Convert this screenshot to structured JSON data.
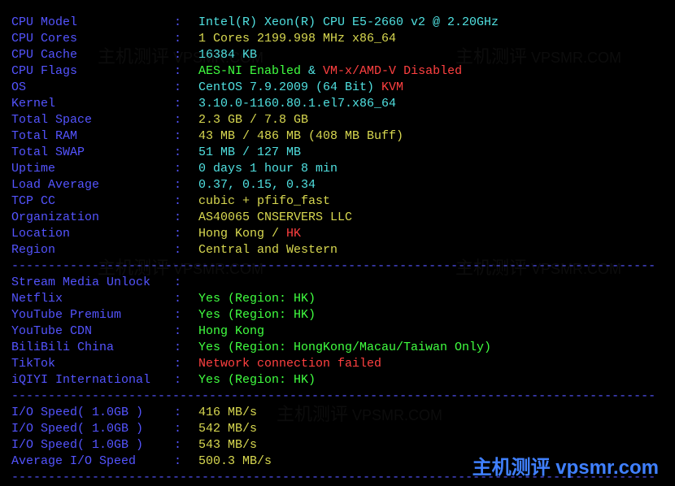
{
  "sep": "----------------------------------------------------------------------------------------",
  "sys": [
    {
      "key": "CPU Model",
      "parts": [
        {
          "cls": "cyan",
          "t": "Intel(R) Xeon(R) CPU E5-2660 v2 @ 2.20GHz"
        }
      ]
    },
    {
      "key": "CPU Cores",
      "parts": [
        {
          "cls": "yellow",
          "t": "1 Cores 2199.998 MHz x86_64"
        }
      ]
    },
    {
      "key": "CPU Cache",
      "parts": [
        {
          "cls": "cyan",
          "t": "16384 KB"
        }
      ]
    },
    {
      "key": "CPU Flags",
      "parts": [
        {
          "cls": "green",
          "t": "AES-NI Enabled"
        },
        {
          "cls": "cyan",
          "t": " & "
        },
        {
          "cls": "red",
          "t": "VM-x/AMD-V Disabled"
        }
      ]
    },
    {
      "key": "OS",
      "parts": [
        {
          "cls": "cyan",
          "t": "CentOS 7.9.2009 (64 Bit) "
        },
        {
          "cls": "red",
          "t": "KVM"
        }
      ]
    },
    {
      "key": "Kernel",
      "parts": [
        {
          "cls": "cyan",
          "t": "3.10.0-1160.80.1.el7.x86_64"
        }
      ]
    },
    {
      "key": "Total Space",
      "parts": [
        {
          "cls": "yellow",
          "t": "2.3 GB / 7.8 GB"
        }
      ]
    },
    {
      "key": "Total RAM",
      "parts": [
        {
          "cls": "yellow",
          "t": "43 MB / 486 MB (408 MB Buff)"
        }
      ]
    },
    {
      "key": "Total SWAP",
      "parts": [
        {
          "cls": "cyan",
          "t": "51 MB / 127 MB"
        }
      ]
    },
    {
      "key": "Uptime",
      "parts": [
        {
          "cls": "cyan",
          "t": "0 days 1 hour 8 min"
        }
      ]
    },
    {
      "key": "Load Average",
      "parts": [
        {
          "cls": "cyan",
          "t": "0.37, 0.15, 0.34"
        }
      ]
    },
    {
      "key": "TCP CC",
      "parts": [
        {
          "cls": "yellow",
          "t": "cubic + pfifo_fast"
        }
      ]
    },
    {
      "key": "Organization",
      "parts": [
        {
          "cls": "yellow",
          "t": "AS40065 CNSERVERS LLC"
        }
      ]
    },
    {
      "key": "Location",
      "parts": [
        {
          "cls": "yellow",
          "t": "Hong Kong / "
        },
        {
          "cls": "red",
          "t": "HK"
        }
      ]
    },
    {
      "key": "Region",
      "parts": [
        {
          "cls": "yellow",
          "t": "Central and Western"
        }
      ]
    }
  ],
  "stream_header": "Stream Media Unlock",
  "stream": [
    {
      "key": "Netflix",
      "parts": [
        {
          "cls": "green",
          "t": "Yes (Region: HK)"
        }
      ]
    },
    {
      "key": "YouTube Premium",
      "parts": [
        {
          "cls": "green",
          "t": "Yes (Region: HK)"
        }
      ]
    },
    {
      "key": "YouTube CDN",
      "parts": [
        {
          "cls": "green",
          "t": "Hong Kong"
        }
      ]
    },
    {
      "key": "BiliBili China",
      "parts": [
        {
          "cls": "green",
          "t": "Yes (Region: HongKong/Macau/Taiwan Only)"
        }
      ]
    },
    {
      "key": "TikTok",
      "parts": [
        {
          "cls": "red",
          "t": "Network connection failed"
        }
      ]
    },
    {
      "key": "iQIYI International",
      "parts": [
        {
          "cls": "green",
          "t": "Yes (Region: HK)"
        }
      ]
    }
  ],
  "io": [
    {
      "key": "I/O Speed( 1.0GB )",
      "parts": [
        {
          "cls": "yellow",
          "t": "416 MB/s"
        }
      ]
    },
    {
      "key": "I/O Speed( 1.0GB )",
      "parts": [
        {
          "cls": "yellow",
          "t": "542 MB/s"
        }
      ]
    },
    {
      "key": "I/O Speed( 1.0GB )",
      "parts": [
        {
          "cls": "yellow",
          "t": "543 MB/s"
        }
      ]
    },
    {
      "key": "Average I/O Speed",
      "parts": [
        {
          "cls": "yellow",
          "t": "500.3 MB/s"
        }
      ]
    }
  ],
  "logo": "主机测评 vpsmr.com",
  "wm_cn": "主机测评",
  "wm_en": "VPSMR.COM"
}
